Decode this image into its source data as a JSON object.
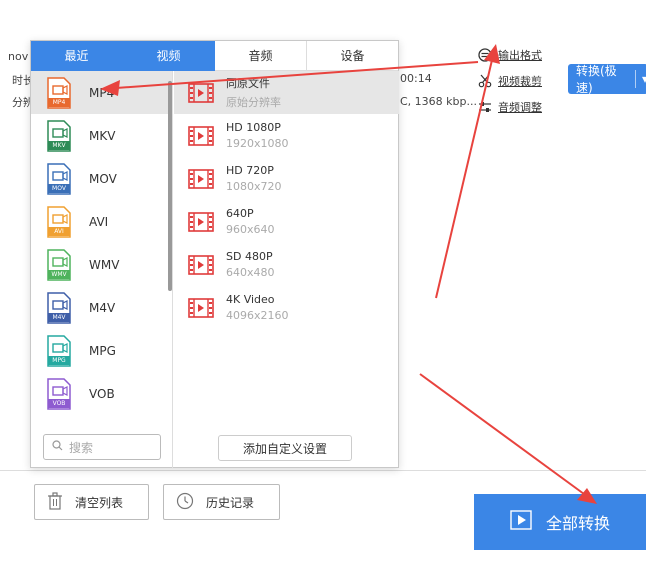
{
  "background": {
    "file_name_fragment": "nov",
    "duration_label_fragment": "时长",
    "resolution_label_fragment": "分辨",
    "time_value": "00:14",
    "codec_value": "C, 1368 kbp...",
    "links": [
      {
        "label": "输出格式",
        "icon": "output-format-icon"
      },
      {
        "label": "视频裁剪",
        "icon": "scissors-icon"
      },
      {
        "label": "音频调整",
        "icon": "audio-adjust-icon"
      }
    ],
    "convert_button": {
      "label": "转换(极速)",
      "dropdown": "▾"
    }
  },
  "popup": {
    "tabs": [
      {
        "label": "最近",
        "active": true
      },
      {
        "label": "视频",
        "active": true
      },
      {
        "label": "音频",
        "active": false
      },
      {
        "label": "设备",
        "active": false
      }
    ],
    "formats": [
      {
        "label": "MP4",
        "badge": "MP4",
        "color": "#e8692e",
        "selected": true
      },
      {
        "label": "MKV",
        "badge": "MKV",
        "color": "#2e8b57",
        "selected": false
      },
      {
        "label": "MOV",
        "badge": "MOV",
        "color": "#3a6fb7",
        "selected": false
      },
      {
        "label": "AVI",
        "badge": "AVI",
        "color": "#f0a030",
        "selected": false
      },
      {
        "label": "WMV",
        "badge": "WMV",
        "color": "#4fb35d",
        "selected": false
      },
      {
        "label": "M4V",
        "badge": "M4V",
        "color": "#3f5fa8",
        "selected": false
      },
      {
        "label": "MPG",
        "badge": "MPG",
        "color": "#25a9a0",
        "selected": false
      },
      {
        "label": "VOB",
        "badge": "VOB",
        "color": "#8e5bd0",
        "selected": false
      }
    ],
    "search_placeholder": "搜索",
    "presets": [
      {
        "name": "同原文件",
        "res": "原始分辨率",
        "selected": true
      },
      {
        "name": "HD 1080P",
        "res": "1920x1080",
        "selected": false
      },
      {
        "name": "HD 720P",
        "res": "1080x720",
        "selected": false
      },
      {
        "name": "640P",
        "res": "960x640",
        "selected": false
      },
      {
        "name": "SD 480P",
        "res": "640x480",
        "selected": false
      },
      {
        "name": "4K Video",
        "res": "4096x2160",
        "selected": false
      }
    ],
    "add_custom_label": "添加自定义设置"
  },
  "bottom": {
    "clear_list_label": "清空列表",
    "history_label": "历史记录",
    "convert_all_label": "全部转换"
  },
  "colors": {
    "accent": "#3b86e6",
    "arrow": "#e8433e",
    "film_icon": "#e03b3b"
  }
}
